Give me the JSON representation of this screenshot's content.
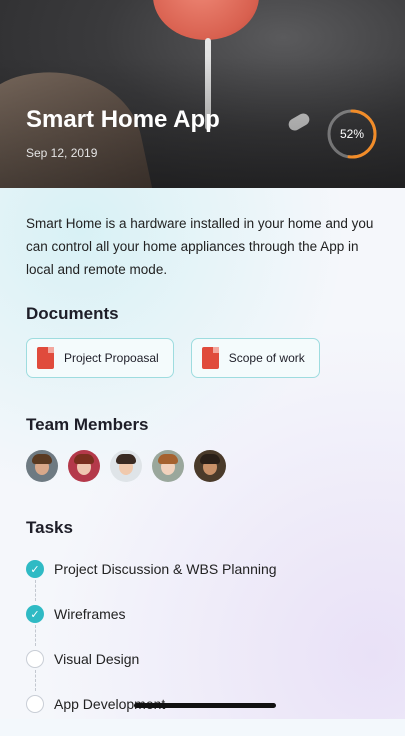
{
  "header": {
    "title": "Smart Home App",
    "date": "Sep 12, 2019",
    "progress": {
      "value": 0.52,
      "label": "52%"
    },
    "colors": {
      "progress_ring": "#f28c28"
    }
  },
  "description": "Smart Home is a hardware installed in your home and you can control all your home appliances through the App in local and remote mode.",
  "documents": {
    "title": "Documents",
    "items": [
      {
        "label": "Project Propoasal",
        "icon": "file-icon"
      },
      {
        "label": "Scope of work",
        "icon": "file-icon"
      }
    ]
  },
  "team": {
    "title": "Team Members",
    "members": [
      {
        "name": "member-1"
      },
      {
        "name": "member-2"
      },
      {
        "name": "member-3"
      },
      {
        "name": "member-4"
      },
      {
        "name": "member-5"
      }
    ]
  },
  "tasks": {
    "title": "Tasks",
    "items": [
      {
        "label": "Project Discussion & WBS Planning",
        "done": true
      },
      {
        "label": "Wireframes",
        "done": true
      },
      {
        "label": "Visual Design",
        "done": false
      },
      {
        "label": "App Development",
        "done": false
      }
    ]
  },
  "colors": {
    "accent": "#2fbac4",
    "document_icon": "#e04b3c"
  }
}
